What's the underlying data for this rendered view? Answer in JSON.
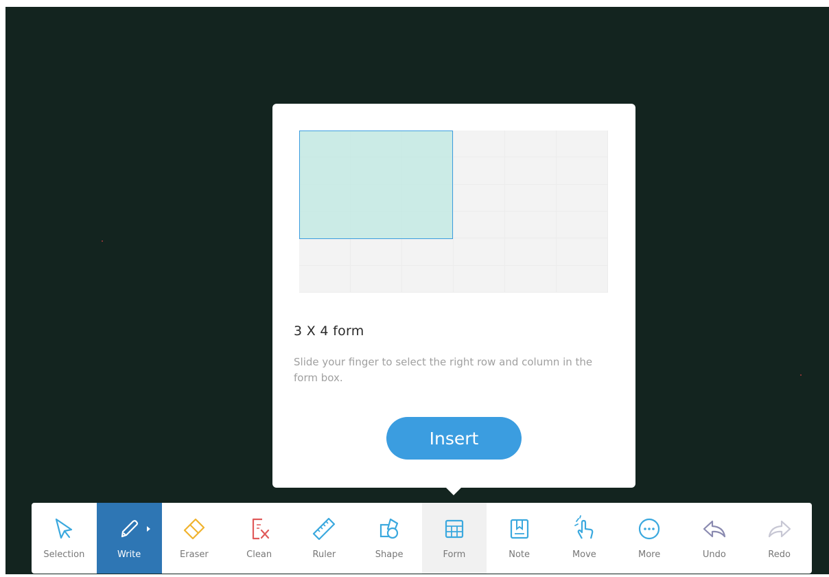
{
  "colors": {
    "board": "#13241f",
    "accent": "#3b9de0",
    "active_tool": "#2e76b4",
    "selection_fill": "#bee8e2"
  },
  "form_popup": {
    "title": "3 X 4 form",
    "description": "Slide your finger to select the right row and column in the form box.",
    "insert_label": "Insert"
  },
  "toolbar": {
    "tools": [
      {
        "label": "Selection",
        "icon": "cursor-icon"
      },
      {
        "label": "Write",
        "icon": "pen-icon",
        "state": "active"
      },
      {
        "label": "Eraser",
        "icon": "eraser-icon"
      },
      {
        "label": "Clean",
        "icon": "clean-icon"
      },
      {
        "label": "Ruler",
        "icon": "ruler-icon"
      },
      {
        "label": "Shape",
        "icon": "shape-icon"
      },
      {
        "label": "Form",
        "icon": "table-icon",
        "state": "hovered"
      },
      {
        "label": "Note",
        "icon": "note-icon"
      },
      {
        "label": "Move",
        "icon": "hand-icon"
      },
      {
        "label": "More",
        "icon": "more-icon"
      },
      {
        "label": "Undo",
        "icon": "undo-icon"
      },
      {
        "label": "Redo",
        "icon": "redo-icon"
      }
    ]
  }
}
